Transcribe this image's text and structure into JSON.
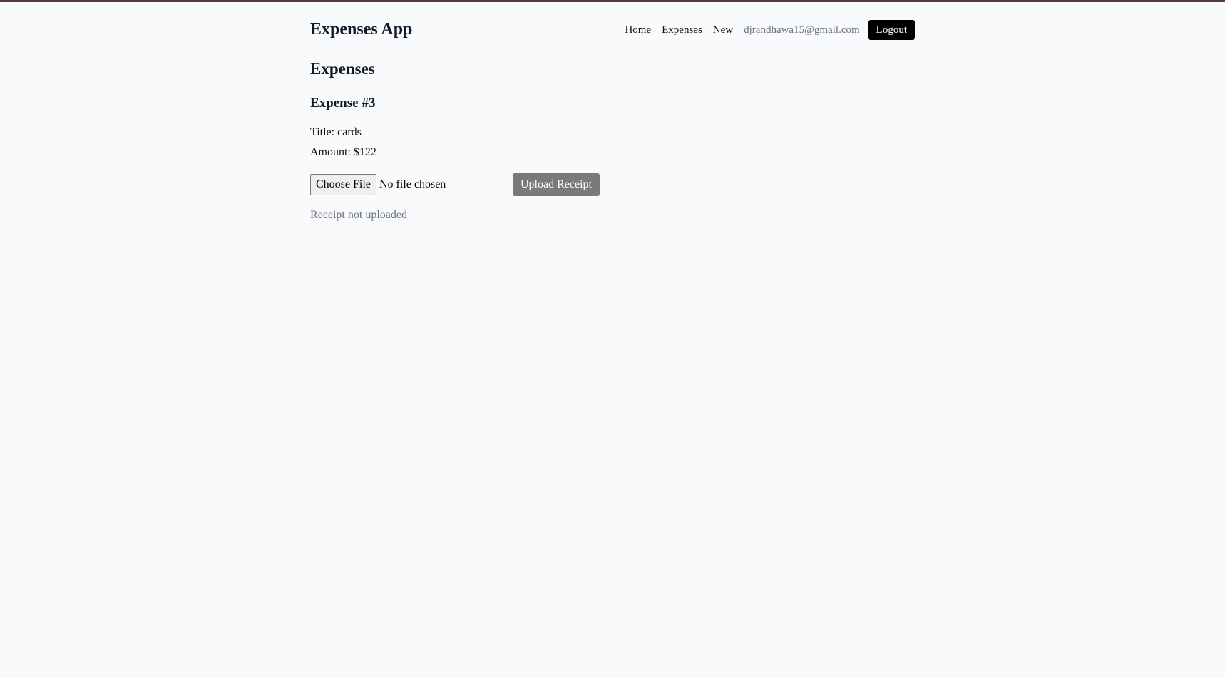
{
  "header": {
    "brand": "Expenses App",
    "nav": [
      {
        "label": "Home"
      },
      {
        "label": "Expenses"
      },
      {
        "label": "New"
      }
    ],
    "user_email": "djrandhawa15@gmail.com",
    "logout_label": "Logout"
  },
  "main": {
    "page_title": "Expenses",
    "expense_heading": "Expense #3",
    "title_line": "Title: cards",
    "amount_line": "Amount: $122",
    "file_input": {
      "button_label": "Choose File",
      "status": "No file chosen"
    },
    "upload_label": "Upload Receipt",
    "receipt_status": "Receipt not uploaded"
  },
  "colors": {
    "background": "#f9fafb",
    "top_border": "#5a3a48",
    "logout_bg": "#000000",
    "upload_bg": "#7a7a7a",
    "muted_text": "#6b7280"
  }
}
